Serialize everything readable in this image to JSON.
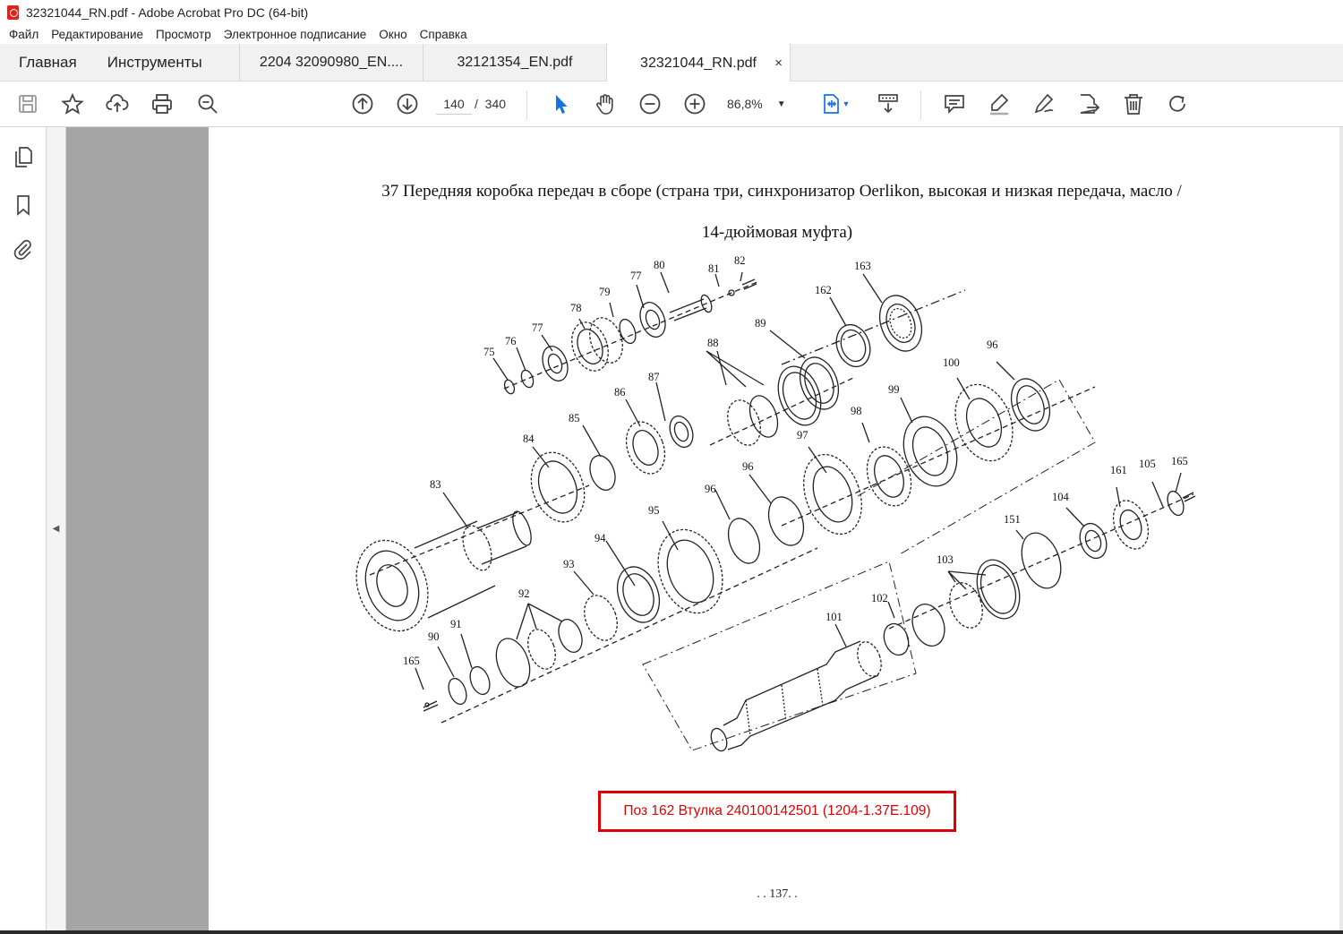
{
  "window": {
    "title": "32321044_RN.pdf - Adobe Acrobat Pro DC (64-bit)"
  },
  "menu": [
    "Файл",
    "Редактирование",
    "Просмотр",
    "Электронное подписание",
    "Окно",
    "Справка"
  ],
  "tabs": {
    "home": "Главная",
    "tools": "Инструменты",
    "docs": [
      {
        "label": "2204 32090980_EN...."
      },
      {
        "label": "32121354_EN.pdf"
      },
      {
        "label": "32321044_RN.pdf",
        "close": "×"
      }
    ]
  },
  "toolbar": {
    "page_current": "140",
    "page_sep": "/",
    "page_total": "340",
    "zoom": "86,8%",
    "icons": [
      "save-icon",
      "star-icon",
      "upload-icon",
      "print-icon",
      "zoom-search-icon",
      "arrow-up-icon",
      "arrow-down-icon",
      "select-pointer-icon",
      "hand-icon",
      "zoom-out-icon",
      "zoom-in-icon",
      "fit-page-icon",
      "scroll-mode-icon",
      "comment-icon",
      "highlight-icon",
      "sign-icon",
      "edit-pdf-icon",
      "delete-icon",
      "redo-icon"
    ]
  },
  "document": {
    "title_line1": "37 Передняя коробка передач в сборе (страна три, синхронизатор Oerlikon, высокая и низкая передача, масло /",
    "title_line2": "14-дюймовая муфта)",
    "note": "Поз 162 Втулка 240100142501 (1204-1.37E.109)",
    "page_number": ". . 137. .",
    "callouts": [
      "75",
      "76",
      "77",
      "78",
      "79",
      "77",
      "80",
      "81",
      "82",
      "163",
      "162",
      "89",
      "88",
      "87",
      "86",
      "85",
      "84",
      "83",
      "96",
      "100",
      "99",
      "98",
      "97",
      "96",
      "96",
      "95",
      "94",
      "93",
      "92",
      "91",
      "90",
      "165",
      "161",
      "105",
      "165",
      "104",
      "151",
      "103",
      "102",
      "101"
    ]
  },
  "colors": {
    "accent": "#1473e6",
    "note_red": "#e00000",
    "gray_margin": "#a5a5a5"
  }
}
